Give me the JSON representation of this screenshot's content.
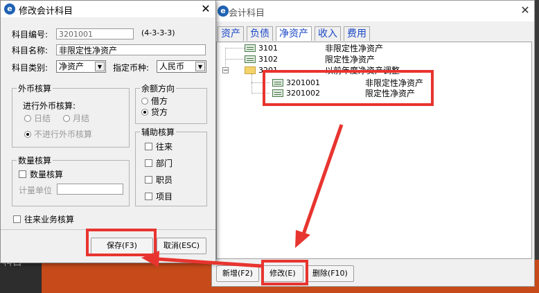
{
  "background": {
    "text": "科目"
  },
  "account_window": {
    "title": "会计科目",
    "logo": "e",
    "close_glyph": "✕",
    "tabs": [
      "资产",
      "负债",
      "净资产",
      "收入",
      "费用"
    ],
    "tree": [
      {
        "code": "3101",
        "name": "非限定性净资产"
      },
      {
        "code": "3102",
        "name": "限定性净资产"
      },
      {
        "code": "3201",
        "name": "以前年度净资产调整",
        "expanded": true
      },
      {
        "code": "3201001",
        "name": "非限定性净资产"
      },
      {
        "code": "3201002",
        "name": "限定性净资产"
      }
    ],
    "buttons": {
      "add": "新增(F2)",
      "edit": "修改(E)",
      "delete": "删除(F10)"
    }
  },
  "dialog": {
    "title": "修改会计科目",
    "logo": "e",
    "close_glyph": "✕",
    "code_label": "科目编号:",
    "code_value": "3201001",
    "code_format": "(4-3-3-3)",
    "name_label": "科目名称:",
    "name_value": "非限定性净资产",
    "type_label": "科目类别:",
    "type_value": "净资产",
    "currency_label": "指定币种:",
    "currency_value": "人民币",
    "foreign": {
      "legend": "外币核算",
      "sub_label": "进行外币核算:",
      "daily": "日结",
      "monthly": "月结",
      "none": "不进行外币核算"
    },
    "balance": {
      "legend": "余额方向",
      "debit": "借方",
      "credit": "贷方"
    },
    "aux": {
      "legend": "辅助核算",
      "items": [
        "往来",
        "部门",
        "职员",
        "项目"
      ]
    },
    "quantity": {
      "legend": "数量核算",
      "check": "数量核算",
      "unit_label": "计量单位"
    },
    "contact_check": "往来业务核算",
    "save_label": "保存(F3)",
    "cancel_label": "取消(ESC)"
  },
  "colors": {
    "annotation": "#e8342f",
    "tab_text": "#1a47c6"
  }
}
